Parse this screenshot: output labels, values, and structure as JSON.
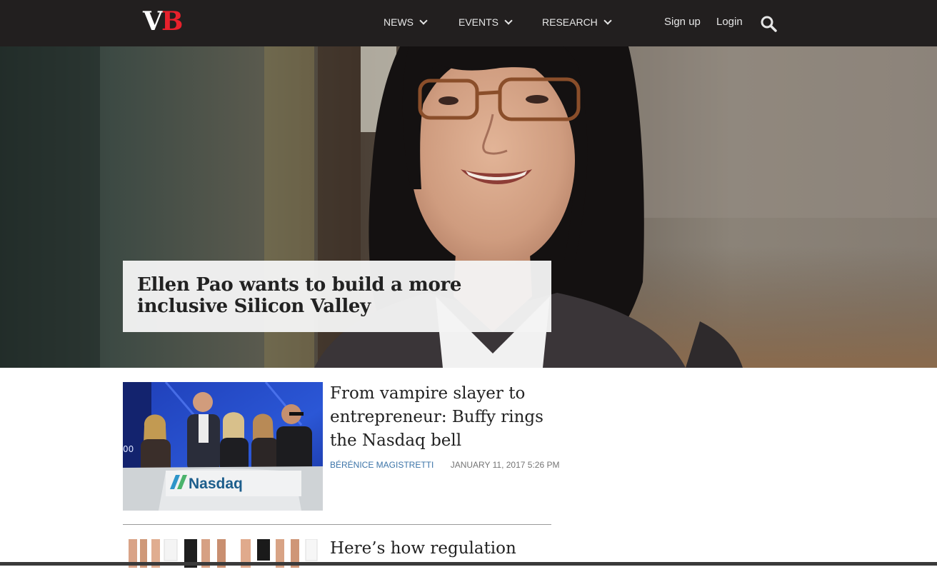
{
  "header": {
    "logo": {
      "v": "V",
      "b": "B"
    },
    "nav": [
      {
        "label": "NEWS"
      },
      {
        "label": "EVENTS"
      },
      {
        "label": "RESEARCH"
      }
    ],
    "signup_label": "Sign up",
    "login_label": "Login",
    "search_icon": "search-icon",
    "colors": {
      "bar": "#221f1f",
      "logo_accent": "#e8212c"
    }
  },
  "hero": {
    "title": "Ellen Pao wants to build a more inclusive Silicon Valley"
  },
  "articles": [
    {
      "title": "From vampire slayer to entrepreneur: Buffy rings the Nasdaq bell",
      "author": "BÉRÉNICE MAGISTRETTI",
      "date": "JANUARY 11, 2017 5:26 PM",
      "thumb_sign": "Nasdaq",
      "thumb_digits": "00"
    },
    {
      "title": "Here’s how regulation"
    }
  ],
  "colors": {
    "author_link": "#3c74a8"
  }
}
